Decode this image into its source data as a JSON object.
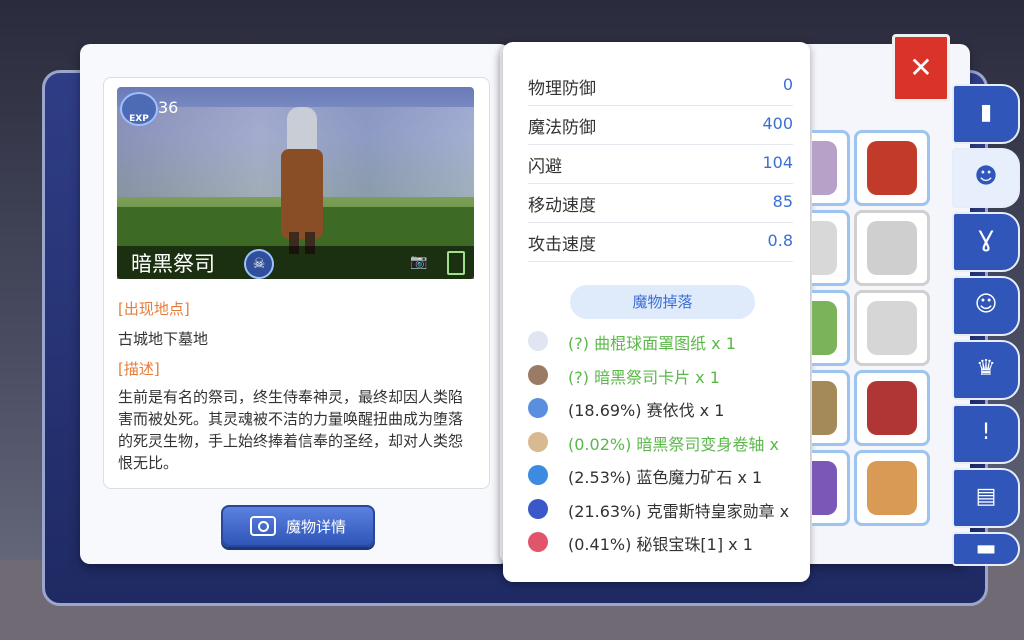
{
  "monster": {
    "exp_label": "EXP",
    "exp_value": "36",
    "name": "暗黑祭司"
  },
  "left_page": {
    "location_header": "[出现地点]",
    "location": "古城地下墓地",
    "description_header": "[描述]",
    "description": "生前是有名的祭司，终生侍奉神灵，最终却因人类陷害而被处死。其灵魂被不洁的力量唤醒扭曲成为堕落的死灵生物，手上始终捧着信奉的圣经，却对人类怨恨无比。",
    "detail_button": "魔物详情"
  },
  "stats": [
    {
      "label": "物理防御",
      "value": "0"
    },
    {
      "label": "魔法防御",
      "value": "400"
    },
    {
      "label": "闪避",
      "value": "104"
    },
    {
      "label": "移动速度",
      "value": "85"
    },
    {
      "label": "攻击速度",
      "value": "0.8"
    }
  ],
  "drops_header": "魔物掉落",
  "drops": [
    {
      "text": "(?) 曲棍球面罩图纸 x 1",
      "style": "green",
      "icon": "blueprint-icon",
      "color": "#dfe6f2"
    },
    {
      "text": "(?) 暗黑祭司卡片 x 1",
      "style": "green",
      "icon": "card-icon",
      "color": "#9a7b66"
    },
    {
      "text": "(18.69%) 赛依伐 x 1",
      "style": "normal",
      "icon": "crystal-icon",
      "color": "#5a8fe0"
    },
    {
      "text": "(0.02%) 暗黑祭司变身卷轴 x",
      "style": "green",
      "icon": "scroll-icon",
      "color": "#d9b98f"
    },
    {
      "text": "(2.53%) 蓝色魔力矿石 x 1",
      "style": "normal",
      "icon": "ore-icon",
      "color": "#3b8be0"
    },
    {
      "text": "(21.63%) 克雷斯特皇家勋章 x",
      "style": "normal",
      "icon": "medal-icon",
      "color": "#3b58c8"
    },
    {
      "text": "(0.41%) 秘银宝珠[1] x 1",
      "style": "normal",
      "icon": "orb-icon",
      "color": "#e0556a"
    }
  ],
  "colors": {
    "accent": "#3b6fd4",
    "section_header": "#e67c3a",
    "drop_green": "#5bb84a",
    "close": "#d9332a"
  },
  "tabs": [
    "book-icon",
    "monster-face-icon",
    "horns-icon",
    "pet-icon",
    "chef-hat-icon",
    "quest-icon",
    "open-book-icon",
    "scroll-tab-icon"
  ]
}
